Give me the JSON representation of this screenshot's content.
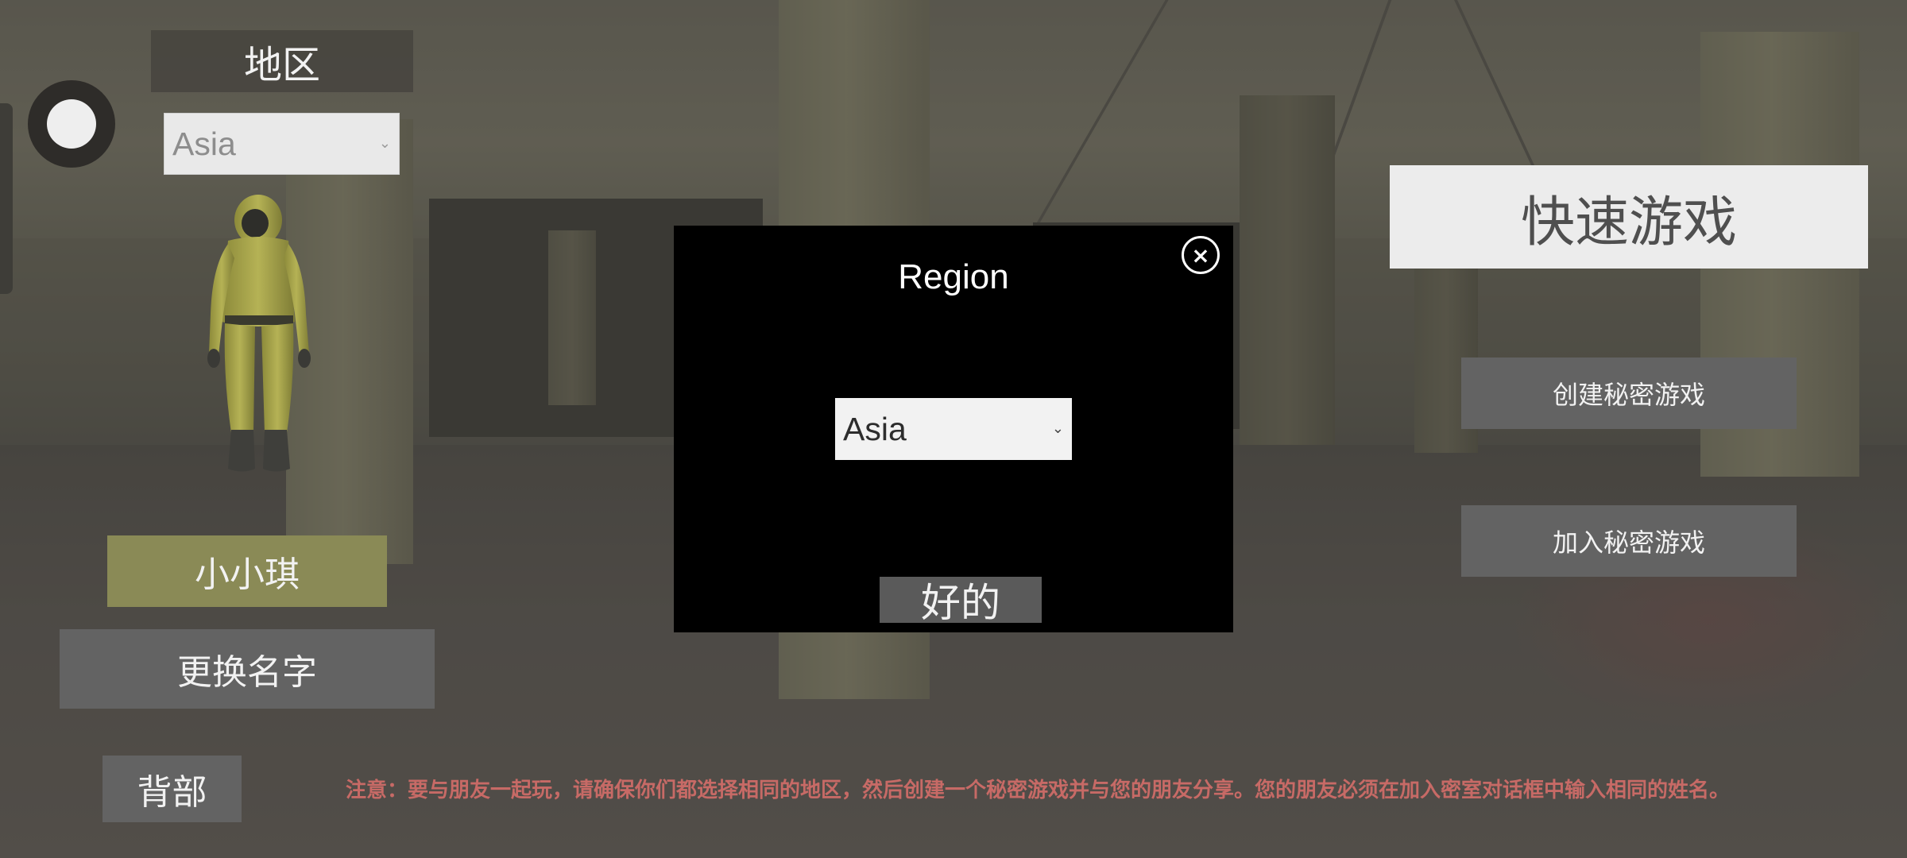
{
  "left_panel": {
    "region_title": "地区",
    "region_select": {
      "value": "Asia"
    },
    "player_name": "小小琪",
    "change_name_label": "更换名字",
    "back_label": "背部"
  },
  "right_panel": {
    "quick_play_label": "快速游戏",
    "create_private_label": "创建秘密游戏",
    "join_private_label": "加入秘密游戏"
  },
  "notice": "注意：要与朋友一起玩，请确保你们都选择相同的地区，然后创建一个秘密游戏并与您的朋友分享。您的朋友必须在加入密室对话框中输入相同的姓名。",
  "modal": {
    "title": "Region",
    "close_glyph": "×",
    "select": {
      "value": "Asia"
    },
    "ok_label": "好的"
  },
  "icons": {
    "joystick": "virtual-joystick-icon",
    "chevron": "chevron-down-icon",
    "close": "close-icon"
  },
  "colors": {
    "name_box": "#8a8a56",
    "notice_text": "#c76a66",
    "button_grey": "#636363",
    "modal_bg": "#000000"
  }
}
